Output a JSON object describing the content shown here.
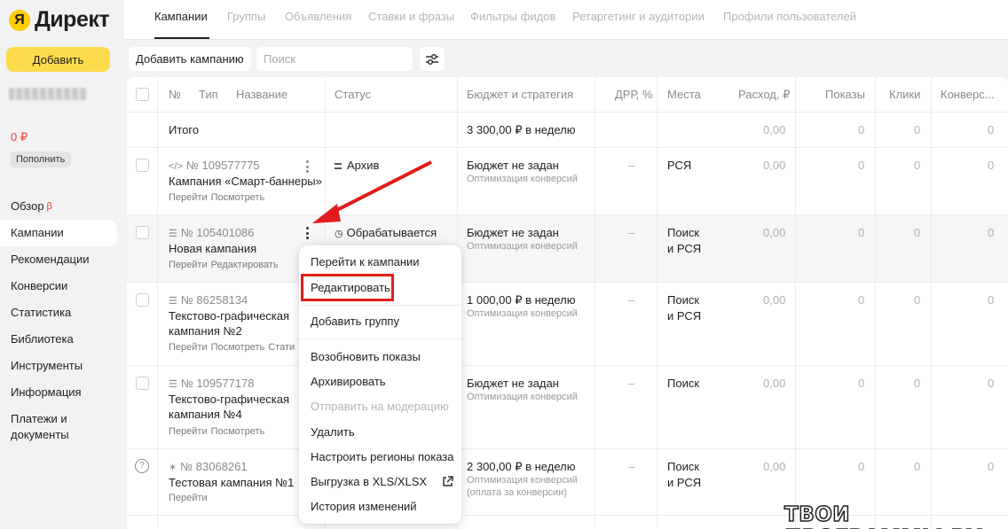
{
  "brand": {
    "logo_letter": "Я",
    "name": "Директ"
  },
  "sidebar": {
    "add_label": "Добавить",
    "balance": "0 ₽",
    "topup_label": "Пополнить",
    "items": [
      {
        "label": "Обзор",
        "badge": "β"
      },
      {
        "label": "Кампании"
      },
      {
        "label": "Рекомендации"
      },
      {
        "label": "Конверсии"
      },
      {
        "label": "Статистика"
      },
      {
        "label": "Библиотека"
      },
      {
        "label": "Инструменты"
      },
      {
        "label": "Информация"
      },
      {
        "label": "Платежи и",
        "label2": "документы"
      }
    ]
  },
  "tabs": [
    "Кампании",
    "Группы",
    "Объявления",
    "Ставки и фразы",
    "Фильтры фидов",
    "Ретаргетинг и аудитории",
    "Профили пользователей"
  ],
  "toolbar": {
    "add_campaign": "Добавить кампанию",
    "search_placeholder": "Поиск"
  },
  "table": {
    "headers": {
      "no": "№",
      "type": "Тип",
      "name": "Название",
      "status": "Статус",
      "budget": "Бюджет и стратегия",
      "drr": "ДРР, %",
      "places": "Места",
      "spend": "Расход, ₽",
      "shows": "Показы",
      "clicks": "Клики",
      "conv": "Конверс..."
    },
    "total": {
      "label": "Итого",
      "budget": "3 300,00 ₽ в неделю",
      "spend": "0,00",
      "shows": "0",
      "clicks": "0",
      "conv": "0"
    },
    "rows": [
      {
        "id": "№ 109577775",
        "name": "Кампания «Смарт-баннеры»",
        "name2": "",
        "links": [
          "Перейти",
          "Посмотреть"
        ],
        "status": "Архив",
        "budget": "Бюджет не задан",
        "strategy": "Оптимизация конверсий",
        "strategy2": "",
        "drr": "–",
        "places": "РСЯ",
        "places2": "",
        "spend": "0,00",
        "shows": "0",
        "clicks": "0",
        "conv": "0"
      },
      {
        "id": "№ 105401086",
        "name": "Новая кампания",
        "name2": "",
        "links": [
          "Перейти",
          "Редактировать"
        ],
        "status": "Обрабатывается",
        "budget": "Бюджет не задан",
        "strategy": "Оптимизация конверсий",
        "strategy2": "",
        "drr": "–",
        "places": "Поиск",
        "places2": "и РСЯ",
        "spend": "0,00",
        "shows": "0",
        "clicks": "0",
        "conv": "0"
      },
      {
        "id": "№ 86258134",
        "name": "Текстово-графическая",
        "name2": "кампания №2",
        "links": [
          "Перейти",
          "Посмотреть",
          "Стати"
        ],
        "status": "",
        "budget": "1 000,00 ₽ в неделю",
        "strategy": "Оптимизация конверсий",
        "strategy2": "",
        "drr": "–",
        "places": "Поиск",
        "places2": "и РСЯ",
        "spend": "0,00",
        "shows": "0",
        "clicks": "0",
        "conv": "0"
      },
      {
        "id": "№ 109577178",
        "name": "Текстово-графическая",
        "name2": "кампания №4",
        "links": [
          "Перейти",
          "Посмотреть"
        ],
        "status": "",
        "budget": "Бюджет не задан",
        "strategy": "Оптимизация конверсий",
        "strategy2": "",
        "drr": "–",
        "places": "Поиск",
        "places2": "",
        "spend": "0,00",
        "shows": "0",
        "clicks": "0",
        "conv": "0"
      },
      {
        "id": "№ 83068261",
        "name": "Тестовая кампания №1",
        "name2": "",
        "links": [
          "Перейти"
        ],
        "status": "",
        "budget": "2 300,00 ₽ в неделю",
        "strategy": "Оптимизация конверсий",
        "strategy2": "(оплата за конверсии)",
        "drr": "–",
        "places": "Поиск",
        "places2": "и РСЯ",
        "spend": "0,00",
        "shows": "0",
        "clicks": "0",
        "conv": "0"
      }
    ]
  },
  "context_menu": {
    "items": [
      "Перейти к кампании",
      "Редактировать",
      "Добавить группу",
      "Возобновить показы",
      "Архивировать",
      "Отправить на модерацию",
      "Удалить",
      "Настроить регионы показа",
      "Выгрузка в XLS/XLSX",
      "История изменений"
    ]
  },
  "watermark": "ТВОИ ПРОГРАММЫ РУ",
  "colors": {
    "accent_yellow": "#fddc4c",
    "highlight_red": "#e21c1c",
    "balance_red": "#e8413b"
  }
}
